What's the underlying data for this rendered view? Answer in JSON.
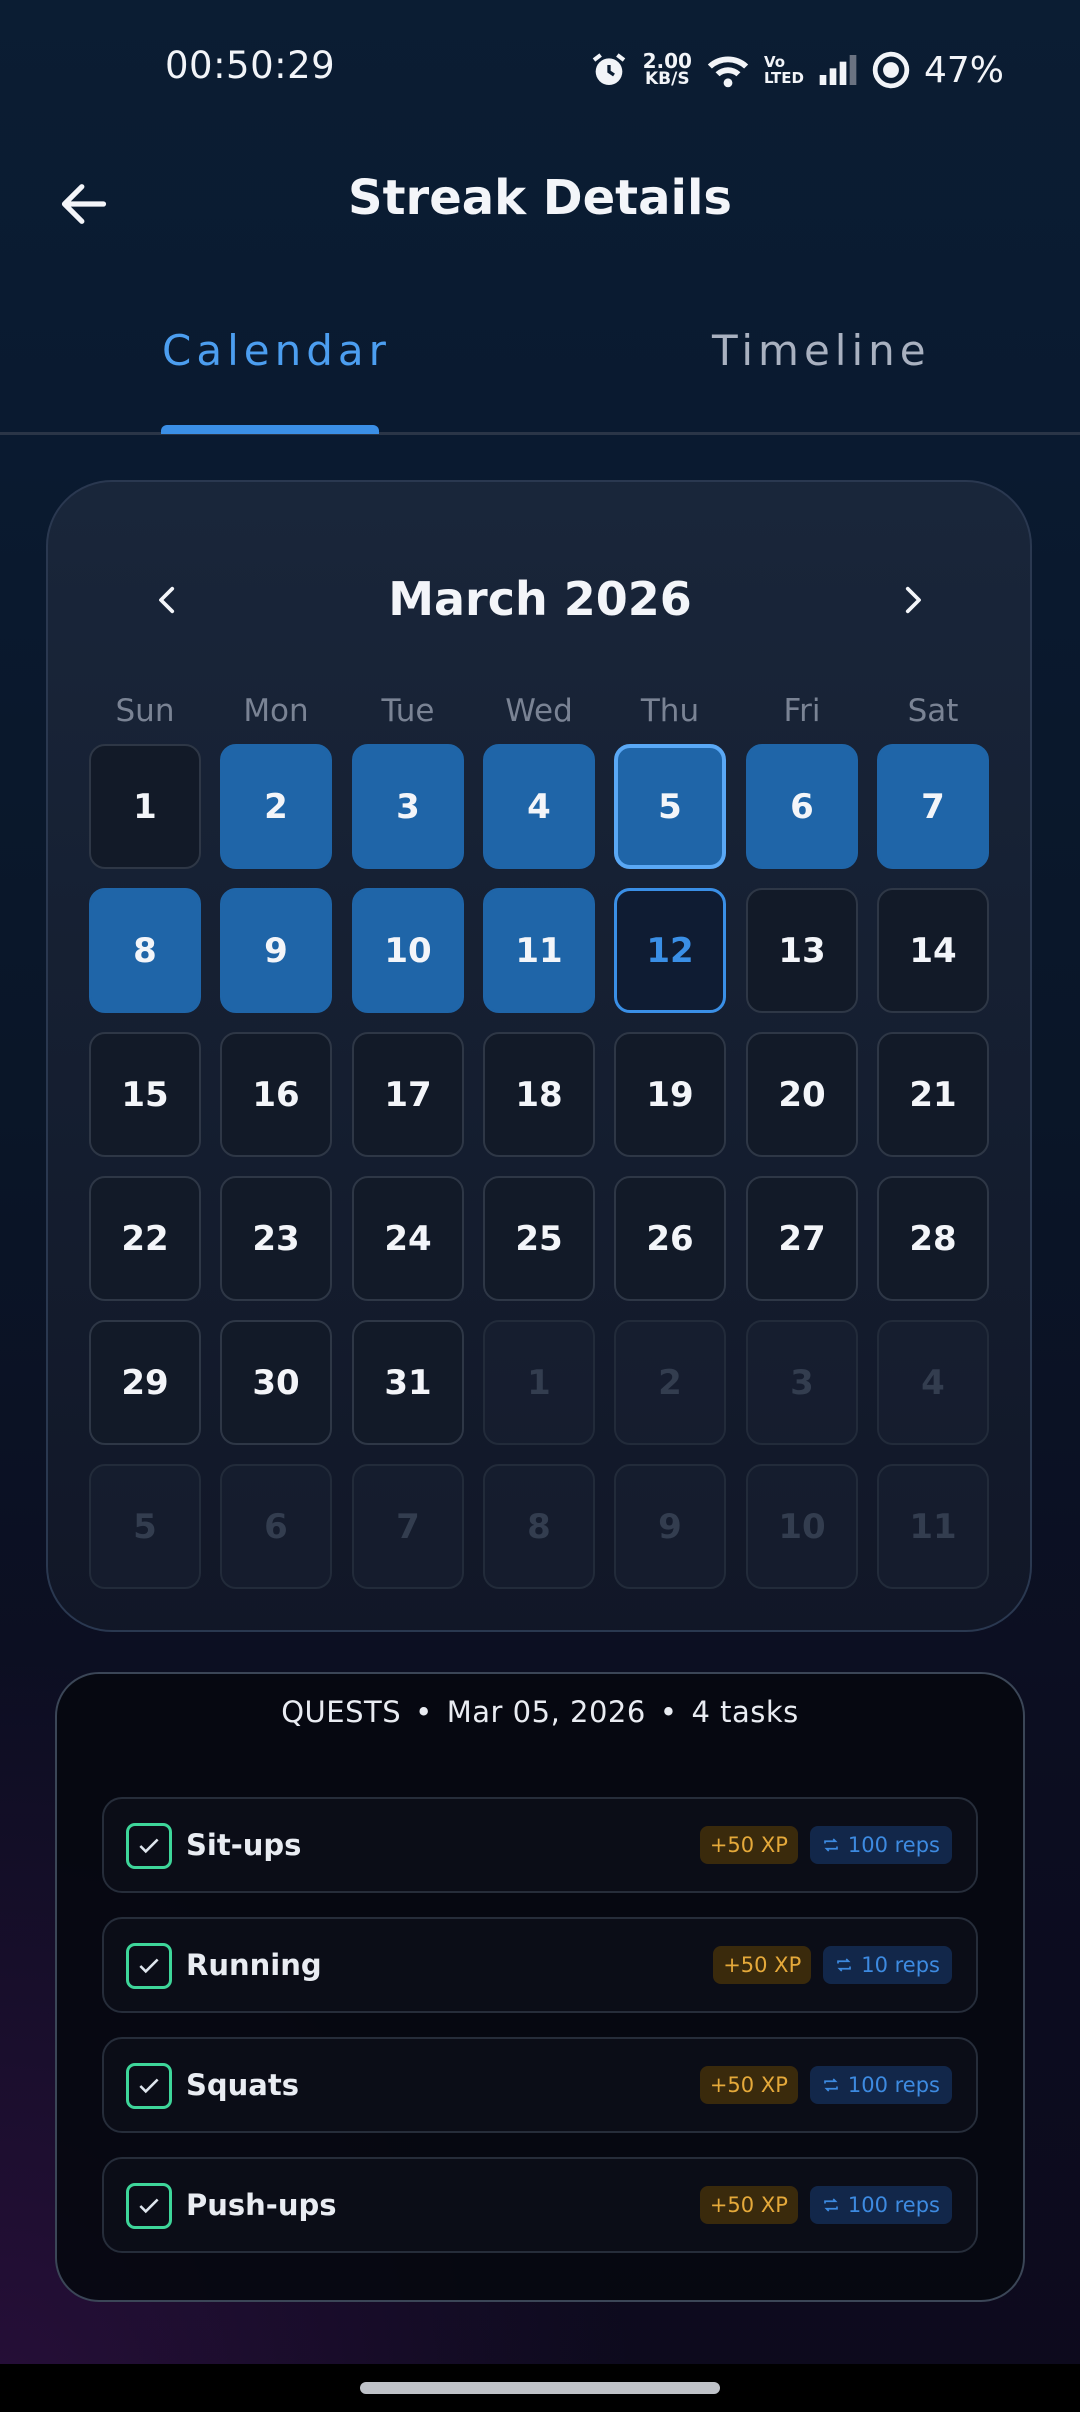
{
  "status_bar": {
    "time": "00:50:29",
    "net_speed_value": "2.00",
    "net_speed_unit": "KB/S",
    "volte_top": "Vo",
    "volte_bottom": "LTED",
    "battery": "47%",
    "icons": [
      "alarm-icon",
      "wifi-icon",
      "signal-icon",
      "battery-icon"
    ]
  },
  "header": {
    "title": "Streak Details",
    "back_icon": "arrow-left-icon"
  },
  "tabs": [
    {
      "label": "Calendar",
      "active": true
    },
    {
      "label": "Timeline",
      "active": false
    }
  ],
  "calendar": {
    "month_label": "March 2026",
    "weekdays": [
      "Sun",
      "Mon",
      "Tue",
      "Wed",
      "Thu",
      "Fri",
      "Sat"
    ],
    "days": [
      {
        "label": "1",
        "state": "plain"
      },
      {
        "label": "2",
        "state": "done"
      },
      {
        "label": "3",
        "state": "done"
      },
      {
        "label": "4",
        "state": "done"
      },
      {
        "label": "5",
        "state": "done-selected"
      },
      {
        "label": "6",
        "state": "done"
      },
      {
        "label": "7",
        "state": "done"
      },
      {
        "label": "8",
        "state": "done"
      },
      {
        "label": "9",
        "state": "done"
      },
      {
        "label": "10",
        "state": "done"
      },
      {
        "label": "11",
        "state": "done"
      },
      {
        "label": "12",
        "state": "today"
      },
      {
        "label": "13",
        "state": "plain"
      },
      {
        "label": "14",
        "state": "plain"
      },
      {
        "label": "15",
        "state": "plain"
      },
      {
        "label": "16",
        "state": "plain"
      },
      {
        "label": "17",
        "state": "plain"
      },
      {
        "label": "18",
        "state": "plain"
      },
      {
        "label": "19",
        "state": "plain"
      },
      {
        "label": "20",
        "state": "plain"
      },
      {
        "label": "21",
        "state": "plain"
      },
      {
        "label": "22",
        "state": "plain"
      },
      {
        "label": "23",
        "state": "plain"
      },
      {
        "label": "24",
        "state": "plain"
      },
      {
        "label": "25",
        "state": "plain"
      },
      {
        "label": "26",
        "state": "plain"
      },
      {
        "label": "27",
        "state": "plain"
      },
      {
        "label": "28",
        "state": "plain"
      },
      {
        "label": "29",
        "state": "plain"
      },
      {
        "label": "30",
        "state": "plain"
      },
      {
        "label": "31",
        "state": "plain"
      },
      {
        "label": "1",
        "state": "other"
      },
      {
        "label": "2",
        "state": "other"
      },
      {
        "label": "3",
        "state": "other"
      },
      {
        "label": "4",
        "state": "other"
      },
      {
        "label": "5",
        "state": "other"
      },
      {
        "label": "6",
        "state": "other"
      },
      {
        "label": "7",
        "state": "other"
      },
      {
        "label": "8",
        "state": "other"
      },
      {
        "label": "9",
        "state": "other"
      },
      {
        "label": "10",
        "state": "other"
      },
      {
        "label": "11",
        "state": "other"
      }
    ]
  },
  "quests": {
    "label": "QUESTS",
    "date": "Mar 05, 2026",
    "count": "4 tasks",
    "separator": "•",
    "items": [
      {
        "name": "Sit-ups",
        "xp": "+50 XP",
        "reps": "100 reps",
        "done": true
      },
      {
        "name": "Running",
        "xp": "+50 XP",
        "reps": "10 reps",
        "done": true
      },
      {
        "name": "Squats",
        "xp": "+50 XP",
        "reps": "100 reps",
        "done": true
      },
      {
        "name": "Push-ups",
        "xp": "+50 XP",
        "reps": "100 reps",
        "done": true
      }
    ]
  },
  "colors": {
    "accent": "#3b8fe6",
    "completed_day": "#1f65a8",
    "check_green": "#3ed69a",
    "xp_text": "#e5a93a",
    "reps_text": "#3d8ae0"
  }
}
